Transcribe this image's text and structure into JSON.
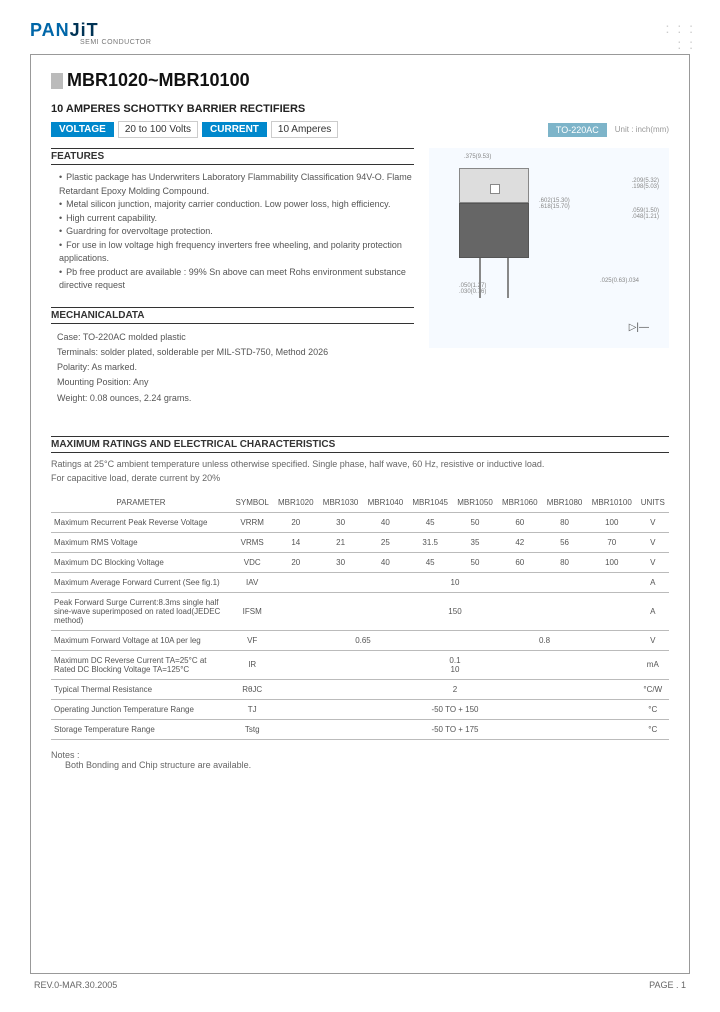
{
  "logo": {
    "p1": "PAN",
    "p2": "JiT",
    "sub": "SEMI\nCONDUCTOR"
  },
  "title": "MBR1020~MBR10100",
  "subtitle": "10 AMPERES SCHOTTKY BARRIER RECTIFIERS",
  "pills": {
    "voltage_label": "VOLTAGE",
    "voltage_val": "20 to 100 Volts",
    "current_label": "CURRENT",
    "current_val": "10 Amperes"
  },
  "package": {
    "label": "TO-220AC",
    "unit": "Unit : inch(mm)"
  },
  "features": {
    "header": "FEATURES",
    "items": [
      "Plastic package has Underwriters Laboratory Flammability Classification 94V-O. Flame Retardant Epoxy Molding Compound.",
      "Metal silicon junction, majority carrier conduction. Low power loss, high efficiency.",
      "High current capability.",
      "Guardring for overvoltage protection.",
      "For use in low voltage high frequency inverters free wheeling, and polarity protection applications.",
      "Pb free product are available : 99% Sn above can meet Rohs environment substance directive request"
    ]
  },
  "mechanical": {
    "header": "MECHANICALDATA",
    "items": [
      "Case: TO-220AC molded plastic",
      "Terminals: solder plated, solderable per MIL-STD-750, Method 2026",
      "Polarity:   As marked.",
      "Mounting Position: Any",
      "Weight: 0.08 ounces, 2.24 grams."
    ]
  },
  "maxratings": {
    "header": "MAXIMUM RATINGS AND ELECTRICAL CHARACTERISTICS",
    "desc1": "Ratings at 25°C ambient temperature unless otherwise specified. Single phase, half wave, 60 Hz, resistive or inductive load.",
    "desc2": "For capacitive load, derate current by 20%"
  },
  "table": {
    "headers": [
      "PARAMETER",
      "SYMBOL",
      "MBR1020",
      "MBR1030",
      "MBR1040",
      "MBR1045",
      "MBR1050",
      "MBR1060",
      "MBR1080",
      "MBR10100",
      "UNITS"
    ],
    "rows": [
      {
        "name": "Maximum Recurrent Peak Reverse Voltage",
        "sym": "VRRM",
        "vals": [
          "20",
          "30",
          "40",
          "45",
          "50",
          "60",
          "80",
          "100"
        ],
        "unit": "V"
      },
      {
        "name": "Maximum RMS Voltage",
        "sym": "VRMS",
        "vals": [
          "14",
          "21",
          "25",
          "31.5",
          "35",
          "42",
          "56",
          "70"
        ],
        "unit": "V"
      },
      {
        "name": "Maximum DC Blocking Voltage",
        "sym": "VDC",
        "vals": [
          "20",
          "30",
          "40",
          "45",
          "50",
          "60",
          "80",
          "100"
        ],
        "unit": "V"
      },
      {
        "name": "Maximum Average Forward  Current (See fig.1)",
        "sym": "IAV",
        "span": "10",
        "unit": "A"
      },
      {
        "name": "Peak Forward Surge Current:8.3ms single half sine-wave superimposed on rated load(JEDEC method)",
        "sym": "IFSM",
        "span": "150",
        "unit": "A"
      },
      {
        "name": "Maximum Forward Voltage at 10A per leg",
        "sym": "VF",
        "span_l": "0.65",
        "span_r": "0.8",
        "unit": "V"
      },
      {
        "name": "Maximum DC Reverse Current TA=25°C\nat Rated DC Blocking Voltage TA=125°C",
        "sym": "IR",
        "span_stack": [
          "0.1",
          "10"
        ],
        "unit": "mA"
      },
      {
        "name": "Typical Thermal Resistance",
        "sym": "RθJC",
        "span": "2",
        "unit": "°C/W"
      },
      {
        "name": "Operating Junction Temperature Range",
        "sym": "TJ",
        "span": "-50 TO + 150",
        "unit": "°C"
      },
      {
        "name": "Storage Temperature Range",
        "sym": "Tstg",
        "span": "-50 TO + 175",
        "unit": "°C"
      }
    ]
  },
  "notes": {
    "label": "Notes :",
    "body": "Both Bonding and Chip structure are available."
  },
  "footer": {
    "rev": "REV.0-MAR.30.2005",
    "page": "PAGE  . 1"
  },
  "diode_symbol": "▷|—"
}
